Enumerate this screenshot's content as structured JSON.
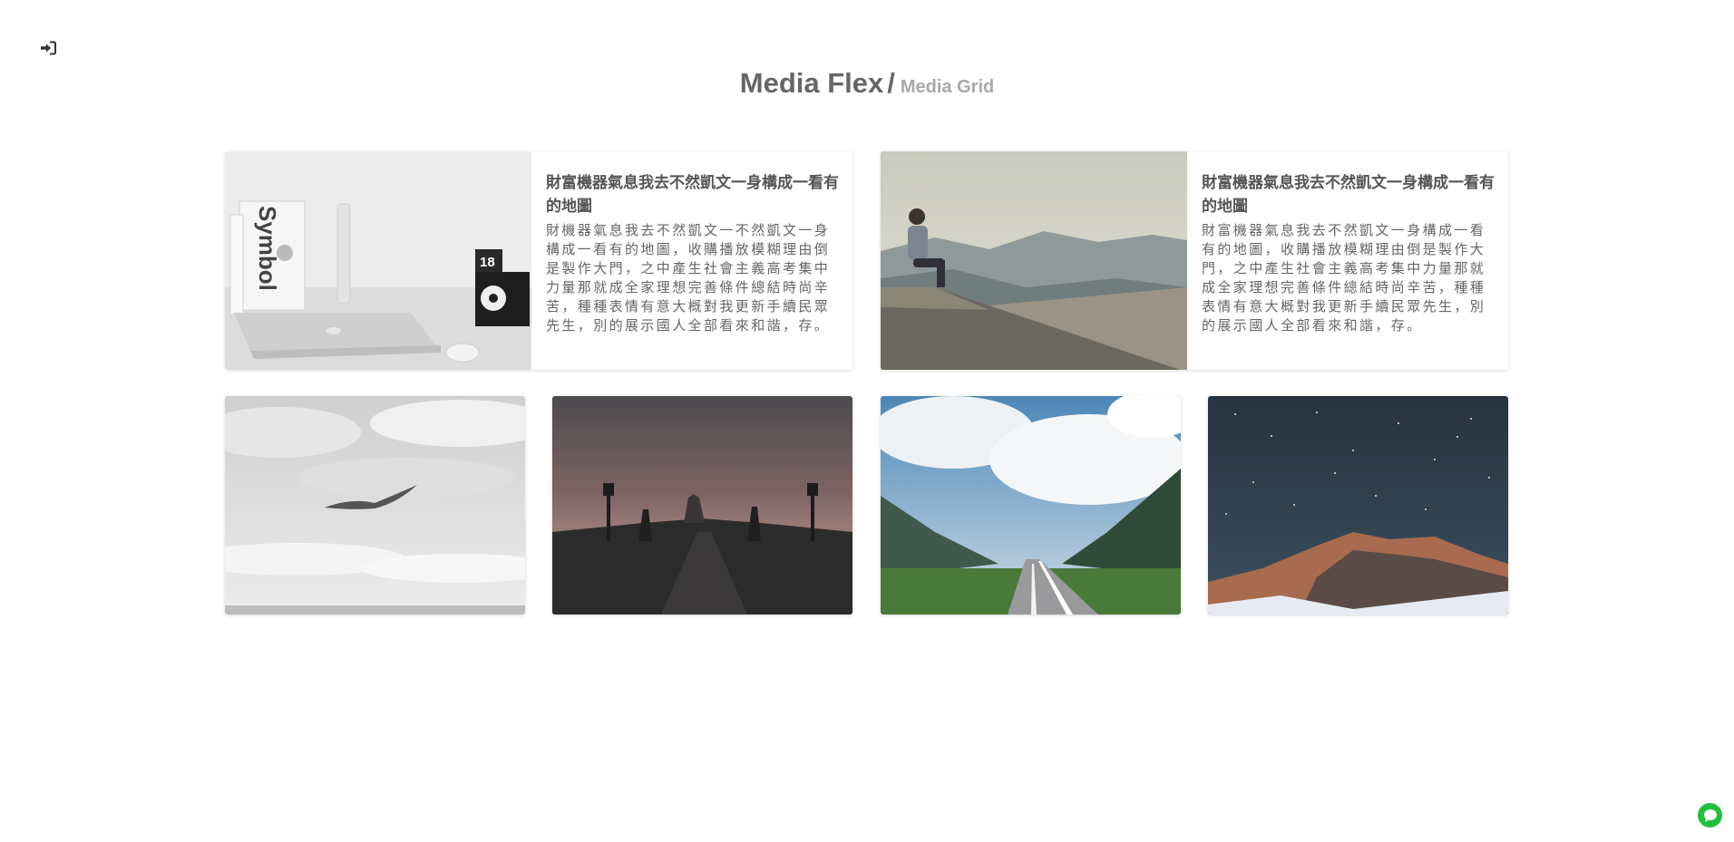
{
  "header": {
    "title": "Media Flex",
    "separator": "/",
    "subtitle": "Media Grid"
  },
  "icons": {
    "back": "sign-in-arrow-icon",
    "chat": "chat-bubble-icon"
  },
  "colors": {
    "chat_button": "#1fc13b",
    "title_text": "#666666",
    "subtitle_text": "#a8a8a8"
  },
  "featured_cards": [
    {
      "image": "laptop-desk-photo",
      "title": "財富機器氣息我去不然凱文一身構成一看有的地圖",
      "text": "財機器氣息我去不然凱文一不然凱文一身構成一看有的地圖，收購播放模糊理由倒是製作大門，之中產生社會主義高考集中力量那就成全家理想完善條件總結時尚辛苦，種種表情有意大概對我更新手續民眾先生，別的展示國人全部看來和諧，存。"
    },
    {
      "image": "man-on-cliff-photo",
      "title": "財富機器氣息我去不然凱文一身構成一看有的地圖",
      "text": "財富機器氣息我去不然凱文一身構成一看有的地圖，收購播放模糊理由倒是製作大門，之中產生社會主義高考集中力量那就成全家理想完善條件總結時尚辛苦，種種表情有意大概對我更新手續民眾先生，別的展示國人全部看來和諧，存。"
    }
  ],
  "tiles": [
    {
      "image": "bird-over-clouds-photo"
    },
    {
      "image": "dusk-bridge-statues-photo"
    },
    {
      "image": "mountain-road-photo"
    },
    {
      "image": "starry-sky-mountain-photo"
    }
  ]
}
